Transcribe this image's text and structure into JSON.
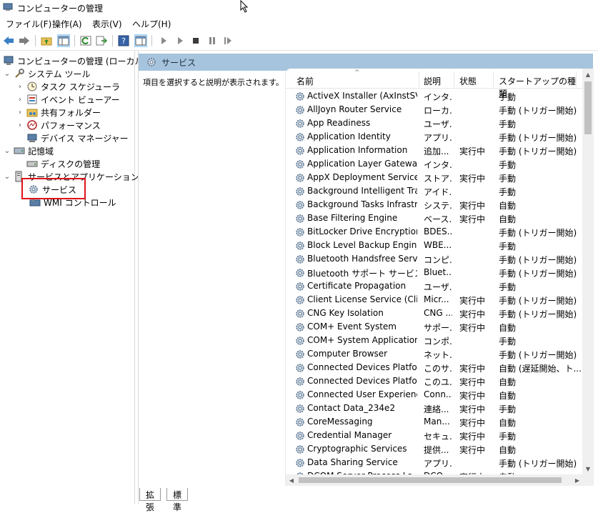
{
  "window": {
    "title": "コンピューターの管理"
  },
  "menu": [
    "ファイル(F)",
    "操作(A)",
    "表示(V)",
    "ヘルプ(H)"
  ],
  "toolbar": [
    "back-icon",
    "forward-icon",
    "up-folder-icon",
    "show-hide-tree-icon",
    "refresh-icon",
    "export-icon",
    "help-icon",
    "show-hide-action-icon",
    "start-icon",
    "start-alt-icon",
    "stop-icon",
    "pause-icon",
    "resume-icon"
  ],
  "tree": {
    "root": "コンピューターの管理 (ローカル)",
    "system_tools": "システム ツール",
    "task_scheduler": "タスク スケジューラ",
    "event_viewer": "イベント ビューアー",
    "shared_folders": "共有フォルダー",
    "performance": "パフォーマンス",
    "device_manager": "デバイス マネージャー",
    "storage": "記憶域",
    "disk_management": "ディスクの管理",
    "services_apps": "サービスとアプリケーション",
    "services": "サービス",
    "wmi": "WMI コントロール"
  },
  "pane": {
    "header": "サービス",
    "description": "項目を選択すると説明が表示されます。"
  },
  "columns": {
    "name": "名前",
    "description": "説明",
    "status": "状態",
    "startup": "スタートアップの種類"
  },
  "services": [
    {
      "name": "ActiveX Installer (AxInstSV)",
      "desc": "インタ...",
      "status": "",
      "startup": "手動"
    },
    {
      "name": "AllJoyn Router Service",
      "desc": "ローカ...",
      "status": "",
      "startup": "手動 (トリガー開始)"
    },
    {
      "name": "App Readiness",
      "desc": "ユーザ...",
      "status": "",
      "startup": "手動"
    },
    {
      "name": "Application Identity",
      "desc": "アプリ...",
      "status": "",
      "startup": "手動 (トリガー開始)"
    },
    {
      "name": "Application Information",
      "desc": "追加...",
      "status": "実行中",
      "startup": "手動 (トリガー開始)"
    },
    {
      "name": "Application Layer Gateway ...",
      "desc": "インタ...",
      "status": "",
      "startup": "手動"
    },
    {
      "name": "AppX Deployment Service (...",
      "desc": "ストア...",
      "status": "実行中",
      "startup": "手動"
    },
    {
      "name": "Background Intelligent Tran...",
      "desc": "アイド...",
      "status": "",
      "startup": "手動"
    },
    {
      "name": "Background Tasks Infrastruc...",
      "desc": "システ...",
      "status": "実行中",
      "startup": "自動"
    },
    {
      "name": "Base Filtering Engine",
      "desc": "ベース...",
      "status": "実行中",
      "startup": "自動"
    },
    {
      "name": "BitLocker Drive Encryption ...",
      "desc": "BDES...",
      "status": "",
      "startup": "手動 (トリガー開始)"
    },
    {
      "name": "Block Level Backup Engine ...",
      "desc": "WBE...",
      "status": "",
      "startup": "手動"
    },
    {
      "name": "Bluetooth Handsfree Service",
      "desc": "コンピ...",
      "status": "",
      "startup": "手動 (トリガー開始)"
    },
    {
      "name": "Bluetooth サポート サービス",
      "desc": "Bluet...",
      "status": "",
      "startup": "手動 (トリガー開始)"
    },
    {
      "name": "Certificate Propagation",
      "desc": "ユーザ...",
      "status": "",
      "startup": "手動"
    },
    {
      "name": "Client License Service (ClipS...",
      "desc": "Micr...",
      "status": "実行中",
      "startup": "手動 (トリガー開始)"
    },
    {
      "name": "CNG Key Isolation",
      "desc": "CNG ...",
      "status": "実行中",
      "startup": "手動 (トリガー開始)"
    },
    {
      "name": "COM+ Event System",
      "desc": "サポー...",
      "status": "実行中",
      "startup": "自動"
    },
    {
      "name": "COM+ System Application",
      "desc": "コンポ...",
      "status": "",
      "startup": "手動"
    },
    {
      "name": "Computer Browser",
      "desc": "ネット...",
      "status": "",
      "startup": "手動 (トリガー開始)"
    },
    {
      "name": "Connected Devices Platfor...",
      "desc": "このサ...",
      "status": "実行中",
      "startup": "自動 (遅延開始、ト..."
    },
    {
      "name": "Connected Devices Platfor...",
      "desc": "このユ...",
      "status": "実行中",
      "startup": "自動"
    },
    {
      "name": "Connected User Experience...",
      "desc": "Conn...",
      "status": "実行中",
      "startup": "自動"
    },
    {
      "name": "Contact Data_234e2",
      "desc": "連絡...",
      "status": "実行中",
      "startup": "手動"
    },
    {
      "name": "CoreMessaging",
      "desc": "Man...",
      "status": "実行中",
      "startup": "自動"
    },
    {
      "name": "Credential Manager",
      "desc": "セキュ...",
      "status": "実行中",
      "startup": "手動"
    },
    {
      "name": "Cryptographic Services",
      "desc": "提供...",
      "status": "実行中",
      "startup": "自動"
    },
    {
      "name": "Data Sharing Service",
      "desc": "アプリ...",
      "status": "",
      "startup": "手動 (トリガー開始)"
    },
    {
      "name": "DCOM Server Process La...",
      "desc": "DCO...",
      "status": "実行中",
      "startup": "自動"
    }
  ],
  "tabs": [
    "拡張",
    "標準"
  ]
}
